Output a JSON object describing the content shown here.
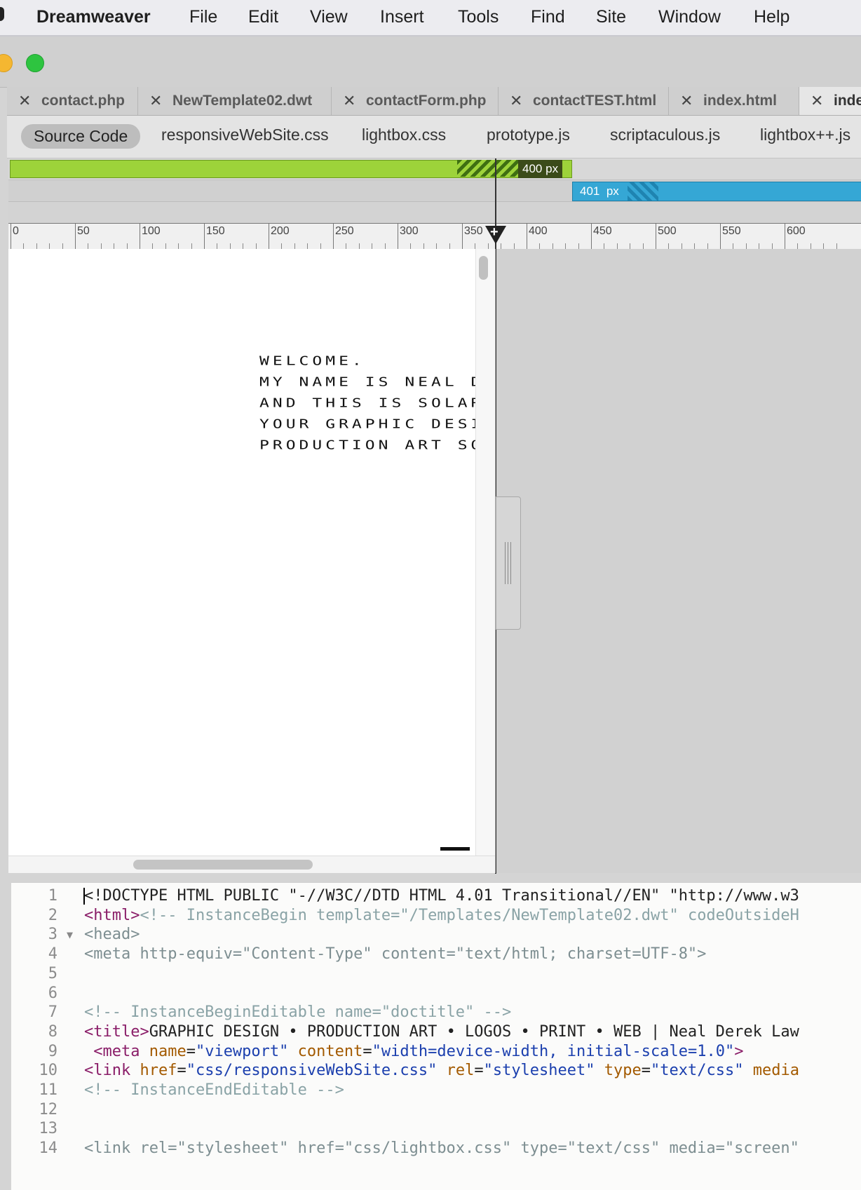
{
  "menubar": {
    "app_name": "Dreamweaver",
    "items": [
      "File",
      "Edit",
      "View",
      "Insert",
      "Tools",
      "Find",
      "Site",
      "Window",
      "Help"
    ]
  },
  "doc_tabs": [
    {
      "label": "contact.php"
    },
    {
      "label": "NewTemplate02.dwt"
    },
    {
      "label": "contactForm.php"
    },
    {
      "label": "contactTEST.html"
    },
    {
      "label": "index.html"
    },
    {
      "label": "index"
    }
  ],
  "related_files": {
    "source": "Source Code",
    "items": [
      "responsiveWebSite.css",
      "lightbox.css",
      "prototype.js",
      "scriptaculous.js",
      "lightbox++.js"
    ]
  },
  "media_queries": {
    "max": {
      "value": "400",
      "unit": "px",
      "color": "#9dd33a"
    },
    "min": {
      "value": "401",
      "unit": "px",
      "color": "#35a7d5"
    }
  },
  "ruler": {
    "labels": [
      "0",
      "50",
      "100",
      "150",
      "200",
      "250",
      "300",
      "350",
      "400",
      "450",
      "500",
      "550",
      "600"
    ],
    "cursor_value": 350
  },
  "live_view": {
    "lines": [
      "WELCOME.",
      "MY NAME IS NEAL DE",
      "AND THIS IS SOLAR",
      "YOUR GRAPHIC DESIG",
      "PRODUCTION ART SOL"
    ]
  },
  "code": {
    "lines": [
      {
        "n": "1",
        "parts": [
          [
            "c-plain",
            "<!DOCTYPE HTML PUBLIC \"-//W3C//DTD HTML 4.01 Transitional//EN\" \"http://www.w3"
          ]
        ]
      },
      {
        "n": "2",
        "parts": [
          [
            "c-tag",
            "<html>"
          ],
          [
            "c-comment",
            "<!-- InstanceBegin template=\"/Templates/NewTemplate02.dwt\" codeOutsideH"
          ]
        ]
      },
      {
        "n": "3",
        "fold": "▼",
        "parts": [
          [
            "c-fade",
            "<head>"
          ]
        ]
      },
      {
        "n": "4",
        "parts": [
          [
            "c-fade",
            "<meta http-equiv=\"Content-Type\" content=\"text/html; charset=UTF-8\">"
          ]
        ]
      },
      {
        "n": "5",
        "parts": []
      },
      {
        "n": "6",
        "parts": []
      },
      {
        "n": "7",
        "parts": [
          [
            "c-comment",
            "<!-- InstanceBeginEditable name=\"doctitle\" -->"
          ]
        ]
      },
      {
        "n": "8",
        "parts": [
          [
            "c-tag",
            "<title>"
          ],
          [
            "c-plain",
            "GRAPHIC DESIGN • PRODUCTION ART • LOGOS • PRINT • WEB | Neal Derek Law"
          ]
        ]
      },
      {
        "n": "9",
        "parts": [
          [
            "c-tag",
            " <meta "
          ],
          [
            "c-attr",
            "name"
          ],
          [
            "c-plain",
            "="
          ],
          [
            "c-val",
            "\"viewport\""
          ],
          [
            "c-attr",
            " content"
          ],
          [
            "c-plain",
            "="
          ],
          [
            "c-val",
            "\"width=device-width, initial-scale=1.0\""
          ],
          [
            "c-tag",
            ">"
          ]
        ]
      },
      {
        "n": "10",
        "parts": [
          [
            "c-tag",
            "<link "
          ],
          [
            "c-attr",
            "href"
          ],
          [
            "c-plain",
            "="
          ],
          [
            "c-val",
            "\"css/responsiveWebSite.css\""
          ],
          [
            "c-attr",
            " rel"
          ],
          [
            "c-plain",
            "="
          ],
          [
            "c-val",
            "\"stylesheet\""
          ],
          [
            "c-attr",
            " type"
          ],
          [
            "c-plain",
            "="
          ],
          [
            "c-val",
            "\"text/css\""
          ],
          [
            "c-attr",
            " media"
          ]
        ]
      },
      {
        "n": "11",
        "parts": [
          [
            "c-comment",
            "<!-- InstanceEndEditable -->"
          ]
        ]
      },
      {
        "n": "12",
        "parts": []
      },
      {
        "n": "13",
        "parts": []
      },
      {
        "n": "14",
        "parts": [
          [
            "c-fade",
            "<link rel=\"stylesheet\" href=\"css/lightbox.css\" type=\"text/css\" media=\"screen\""
          ]
        ]
      }
    ]
  }
}
